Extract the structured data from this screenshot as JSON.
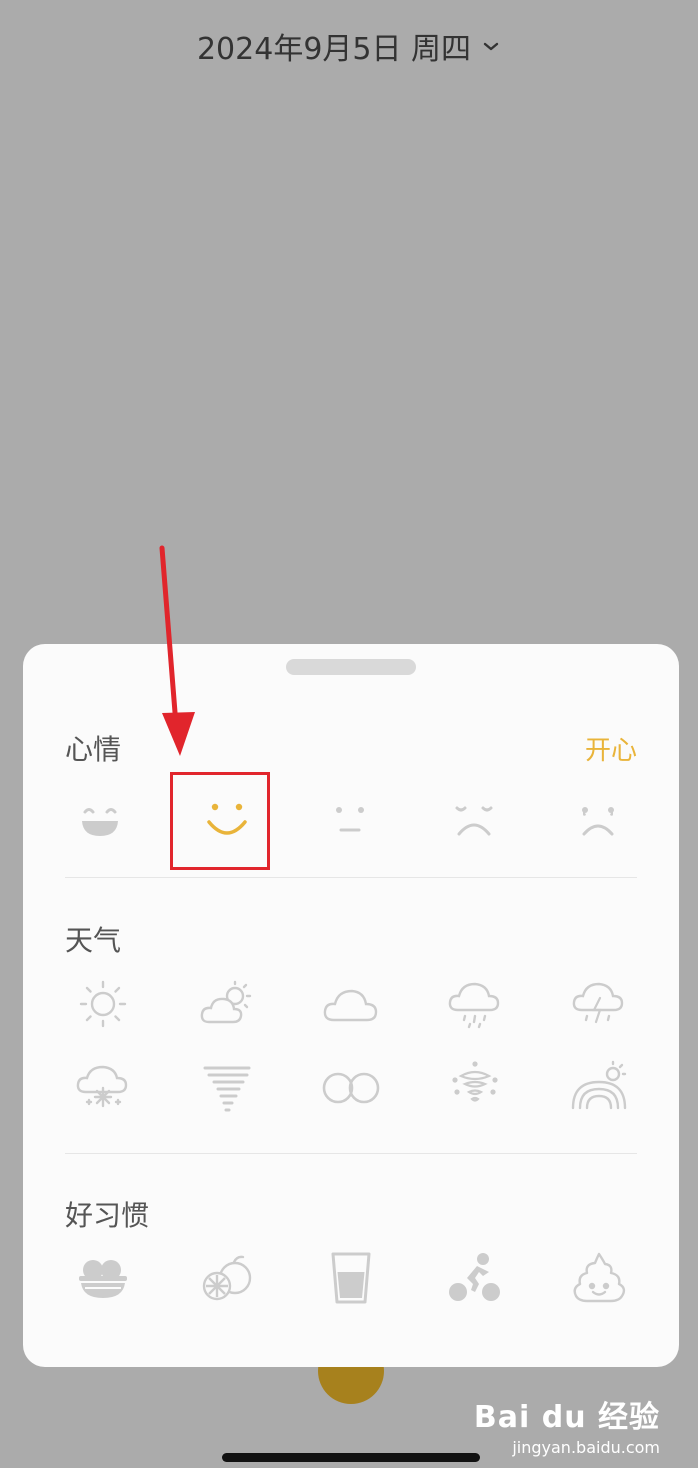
{
  "header": {
    "date": "2024年9月5日 周四",
    "dropdown_icon": "chevron-down-icon"
  },
  "sheet": {
    "mood": {
      "title": "心情",
      "selected_value": "开心",
      "selected_index": 1,
      "accent_color": "#e9b43a",
      "icons": [
        "laughing-face-icon",
        "smile-face-icon",
        "neutral-face-icon",
        "sad-face-icon",
        "crying-face-icon"
      ]
    },
    "weather": {
      "title": "天气",
      "icons": [
        "sunny-icon",
        "partly-cloudy-icon",
        "cloudy-icon",
        "rain-icon",
        "thunderstorm-icon",
        "snow-icon",
        "tornado-icon",
        "fog-icon",
        "hurricane-icon",
        "rainbow-icon"
      ]
    },
    "habits": {
      "title": "好习惯",
      "icons": [
        "rice-bowl-icon",
        "fruit-icon",
        "water-glass-icon",
        "cycling-icon",
        "poop-icon"
      ]
    }
  },
  "watermark": {
    "logo": "Bai du 经验",
    "url": "jingyan.baidu.com"
  },
  "colors": {
    "backdrop": "#ababab",
    "sheet": "#fbfbfb",
    "icon_inactive": "#cccccc",
    "highlight": "#e1252c",
    "fab": "#a7811d"
  }
}
